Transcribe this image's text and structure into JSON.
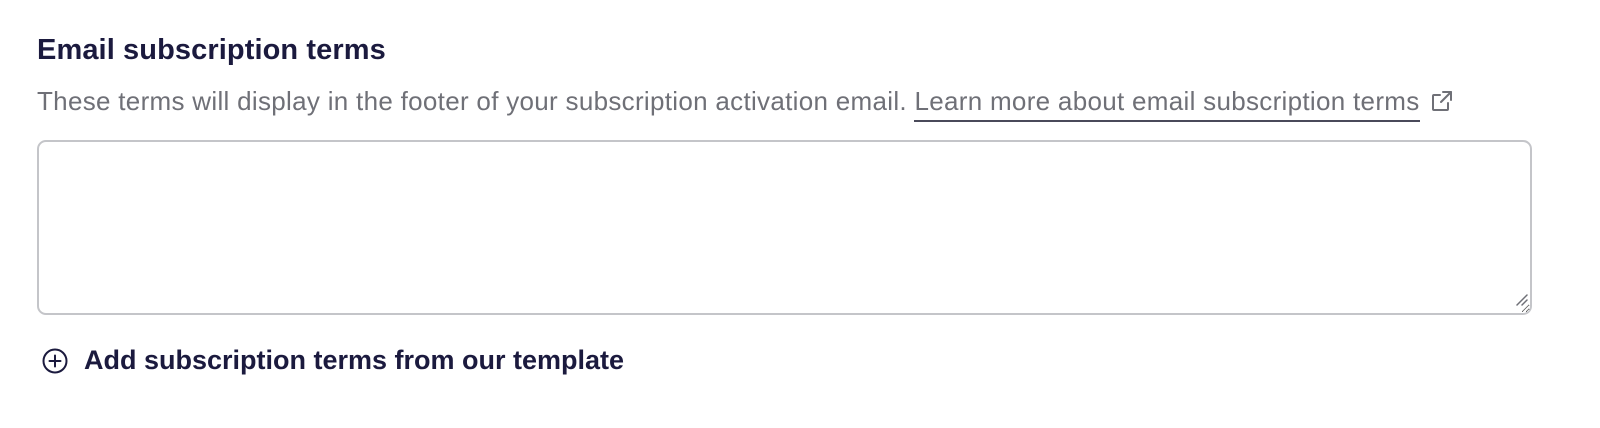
{
  "section": {
    "title": "Email subscription terms",
    "description": "These terms will display in the footer of your subscription activation email.",
    "learn_more_link": "Learn more about email subscription terms",
    "external_link_icon": "external-link-icon"
  },
  "terms_textarea": {
    "value": "",
    "placeholder": ""
  },
  "add_template": {
    "icon": "plus-circle-icon",
    "label": "Add subscription terms from our template"
  },
  "colors": {
    "heading": "#1b1a3e",
    "muted_text": "#6f7077",
    "border": "#c4c5c9"
  }
}
